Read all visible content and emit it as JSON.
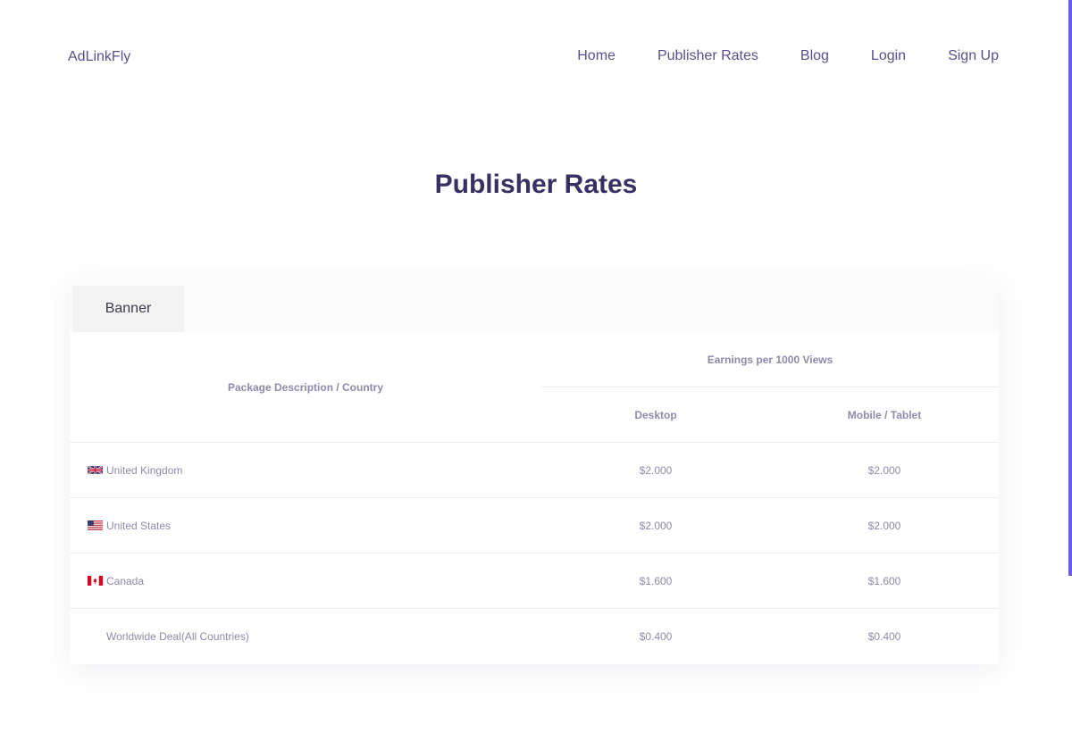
{
  "brand": "AdLinkFly",
  "nav": [
    {
      "label": "Home"
    },
    {
      "label": "Publisher Rates"
    },
    {
      "label": "Blog"
    },
    {
      "label": "Login"
    },
    {
      "label": "Sign Up"
    }
  ],
  "page_title": "Publisher Rates",
  "tabs": [
    {
      "label": "Banner",
      "active": true
    }
  ],
  "table": {
    "col_package": "Package Description / Country",
    "col_earnings": "Earnings per 1000 Views",
    "col_desktop": "Desktop",
    "col_mobile": "Mobile / Tablet",
    "rows": [
      {
        "flag": "gb-flag-icon",
        "country": "United Kingdom",
        "desktop": "$2.000",
        "mobile": "$2.000"
      },
      {
        "flag": "us-flag-icon",
        "country": "United States",
        "desktop": "$2.000",
        "mobile": "$2.000"
      },
      {
        "flag": "ca-flag-icon",
        "country": "Canada",
        "desktop": "$1.600",
        "mobile": "$1.600"
      },
      {
        "flag": "",
        "country": "Worldwide Deal(All Countries)",
        "desktop": "$0.400",
        "mobile": "$0.400"
      }
    ]
  },
  "colors": {
    "accent": "#6c5ce7",
    "title": "#3a2f63",
    "nav_text": "#5d4f8e",
    "table_text": "#8e8bab"
  }
}
